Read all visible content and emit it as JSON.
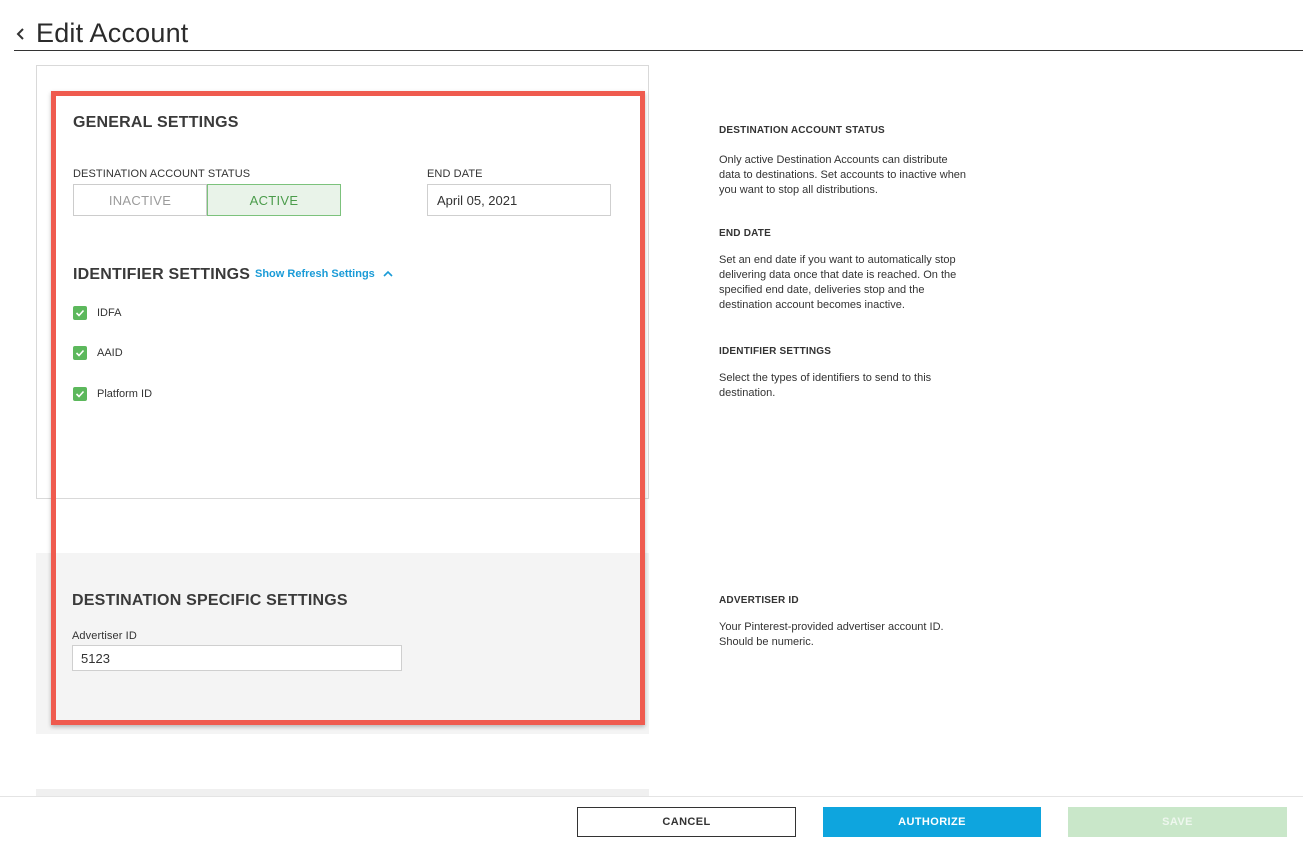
{
  "header": {
    "title": "Edit Account"
  },
  "general": {
    "title": "GENERAL SETTINGS",
    "status_label": "DESTINATION ACCOUNT STATUS",
    "status_options": {
      "inactive": "INACTIVE",
      "active": "ACTIVE"
    },
    "selected_status": "ACTIVE",
    "end_date_label": "END DATE",
    "end_date_value": "April 05, 2021"
  },
  "identifier": {
    "title": "IDENTIFIER SETTINGS",
    "refresh_link": "Show Refresh Settings",
    "items": [
      {
        "label": "IDFA",
        "checked": true
      },
      {
        "label": "AAID",
        "checked": true
      },
      {
        "label": "Platform ID",
        "checked": true
      }
    ]
  },
  "destination": {
    "title": "DESTINATION SPECIFIC SETTINGS",
    "advertiser_label": "Advertiser ID",
    "advertiser_value": "5123"
  },
  "help": {
    "status": {
      "title": "DESTINATION ACCOUNT STATUS",
      "lines": [
        "Only active Destination Accounts can distribute",
        "data to destinations. Set accounts to inactive when",
        "you want to stop all distributions."
      ]
    },
    "end_date": {
      "title": "END DATE",
      "lines": [
        "Set an end date if you want to automatically stop",
        "delivering data once that date is reached. On the",
        "specified end date, deliveries stop and the",
        "destination account becomes inactive."
      ]
    },
    "identifier": {
      "title": "IDENTIFIER SETTINGS",
      "lines": [
        "Select the types of identifiers to send to this",
        "destination."
      ]
    },
    "advertiser": {
      "title": "ADVERTISER ID",
      "lines": [
        "Your Pinterest-provided advertiser account ID.",
        "Should be numeric."
      ]
    }
  },
  "footer": {
    "cancel": "CANCEL",
    "authorize": "AUTHORIZE",
    "save": "SAVE"
  },
  "colors": {
    "accent_blue": "#0ea5de",
    "active_green": "#5cb85c",
    "highlight_red": "#ef5b4f",
    "save_disabled": "#c9e7c9"
  },
  "icons": {
    "back": "chevron-left-icon",
    "refresh_toggle": "chevron-up-icon",
    "checkbox": "checkmark-icon"
  }
}
